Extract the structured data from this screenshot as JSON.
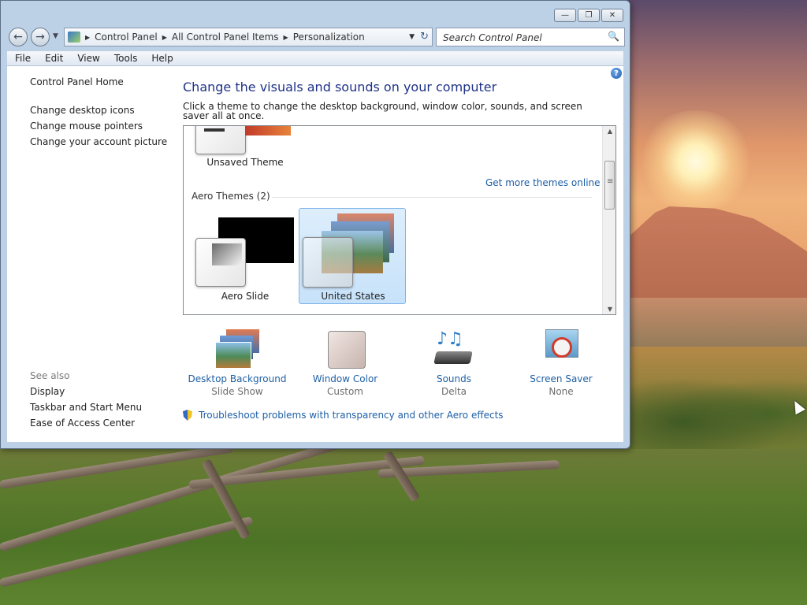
{
  "window": {
    "controls": {
      "minimize": "—",
      "restore": "❐",
      "close": "✕"
    },
    "breadcrumbs": [
      "Control Panel",
      "All Control Panel Items",
      "Personalization"
    ],
    "search_placeholder": "Search Control Panel",
    "menu": [
      "File",
      "Edit",
      "View",
      "Tools",
      "Help"
    ]
  },
  "sidebar": {
    "home": "Control Panel Home",
    "links": [
      "Change desktop icons",
      "Change mouse pointers",
      "Change your account picture"
    ],
    "see_also_title": "See also",
    "see_also": [
      "Display",
      "Taskbar and Start Menu",
      "Ease of Access Center"
    ]
  },
  "main": {
    "heading": "Change the visuals and sounds on your computer",
    "subtext": "Click a theme to change the desktop background, window color, sounds, and screen saver all at once.",
    "themes": {
      "unsaved_label": "Unsaved Theme",
      "get_more": "Get more themes online",
      "aero_group": "Aero Themes (2)",
      "items": [
        {
          "label": "Aero Slide",
          "selected": false
        },
        {
          "label": "United States",
          "selected": true
        }
      ]
    },
    "options": [
      {
        "title": "Desktop Background",
        "value": "Slide Show",
        "icon": "desktop-background-icon"
      },
      {
        "title": "Window Color",
        "value": "Custom",
        "icon": "window-color-icon"
      },
      {
        "title": "Sounds",
        "value": "Delta",
        "icon": "sounds-icon"
      },
      {
        "title": "Screen Saver",
        "value": "None",
        "icon": "screen-saver-icon"
      }
    ],
    "troubleshoot": "Troubleshoot problems with transparency and other Aero effects"
  },
  "colors": {
    "link": "#1e5fa6",
    "heading": "#1e3287",
    "selection": "#cce4f8"
  }
}
